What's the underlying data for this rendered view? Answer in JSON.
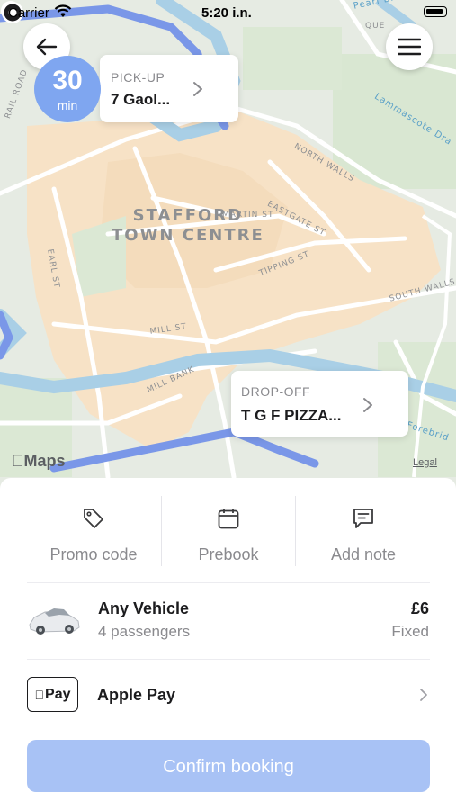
{
  "status_bar": {
    "carrier": "Carrier",
    "time": "5:20 i.n."
  },
  "map": {
    "town_centre": [
      "STAFFORD",
      "TOWN CENTRE"
    ],
    "streets": {
      "martin_st": "MARTIN ST",
      "eastgate_st": "EASTGATE ST",
      "north_walls": "NORTH WALLS",
      "tipping_st": "TIPPING ST",
      "south_walls": "SOUTH WALLS",
      "mill_st": "MILL ST",
      "mill_bank": "MILL BANK",
      "earl_st": "EARL ST",
      "lammascote": "Lammascote Dra",
      "pearl_brook": "Pearl Broo",
      "forebridge": "Forebrid",
      "que": "QUE",
      "rail_road": "RAIL ROAD"
    },
    "brand": "Maps",
    "legal": "Legal"
  },
  "eta": {
    "value": "30",
    "unit": "min"
  },
  "pickup": {
    "caption": "PICK-UP",
    "address": "7 Gaol..."
  },
  "dropoff": {
    "caption": "DROP-OFF",
    "address": "T G F PIZZA..."
  },
  "options": {
    "promo": "Promo code",
    "prebook": "Prebook",
    "note": "Add note"
  },
  "vehicle": {
    "name": "Any Vehicle",
    "passengers": "4 passengers",
    "price": "£6",
    "price_type": "Fixed"
  },
  "payment": {
    "logo_text": "Pay",
    "method": "Apple Pay"
  },
  "confirm_label": "Confirm booking",
  "colors": {
    "accent": "#7fa6f0",
    "confirm_disabled": "#a8c2f5",
    "route": "#7a97e8"
  }
}
